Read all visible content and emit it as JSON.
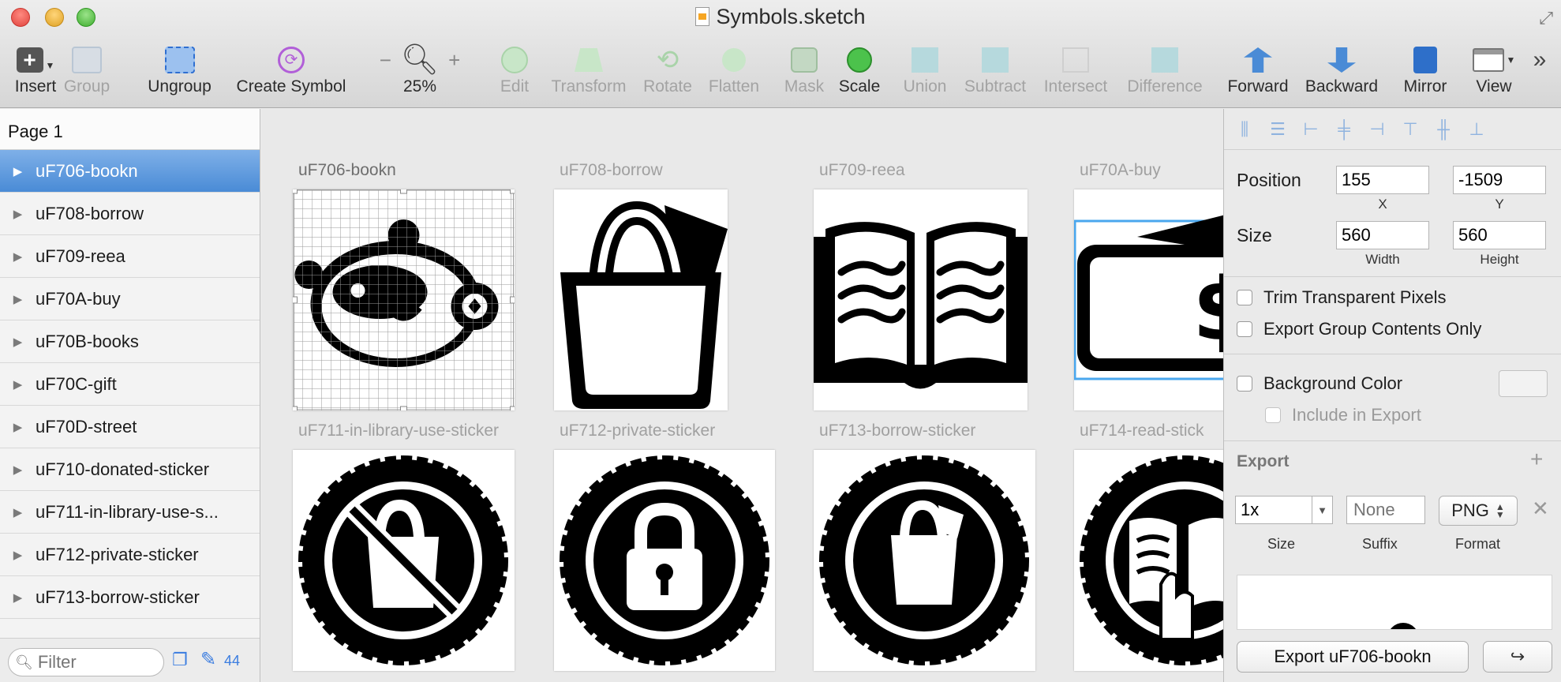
{
  "window": {
    "title": "Symbols.sketch"
  },
  "toolbar": {
    "insert": "Insert",
    "group": "Group",
    "ungroup": "Ungroup",
    "create_symbol": "Create Symbol",
    "zoom_minus": "−",
    "zoom_plus": "+",
    "zoom": "25%",
    "edit": "Edit",
    "transform": "Transform",
    "rotate": "Rotate",
    "flatten": "Flatten",
    "mask": "Mask",
    "scale": "Scale",
    "union": "Union",
    "subtract": "Subtract",
    "intersect": "Intersect",
    "difference": "Difference",
    "forward": "Forward",
    "backward": "Backward",
    "mirror": "Mirror",
    "view": "View",
    "overflow": "»"
  },
  "sidebar": {
    "page": "Page 1",
    "layers": [
      {
        "name": "uF706-bookn",
        "selected": true
      },
      {
        "name": "uF708-borrow"
      },
      {
        "name": "uF709-reea"
      },
      {
        "name": "uF70A-buy"
      },
      {
        "name": "uF70B-books"
      },
      {
        "name": "uF70C-gift"
      },
      {
        "name": "uF70D-street"
      },
      {
        "name": "uF710-donated-sticker"
      },
      {
        "name": "uF711-in-library-use-s..."
      },
      {
        "name": "uF712-private-sticker"
      },
      {
        "name": "uF713-borrow-sticker"
      }
    ],
    "filter_placeholder": "Filter",
    "count": "44"
  },
  "canvas": {
    "artboards": [
      {
        "label": "uF706-bookn",
        "icon": "bear-face-icon",
        "selected": true
      },
      {
        "label": "uF708-borrow",
        "icon": "shopping-bag-icon"
      },
      {
        "label": "uF709-reea",
        "icon": "open-book-icon"
      },
      {
        "label": "uF70A-buy",
        "icon": "dollar-bill-icon"
      },
      {
        "label": "uF711-in-library-use-sticker",
        "icon": "no-bag-sticker-icon"
      },
      {
        "label": "uF712-private-sticker",
        "icon": "lock-sticker-icon"
      },
      {
        "label": "uF713-borrow-sticker",
        "icon": "bag-sticker-icon"
      },
      {
        "label": "uF714-read-stick",
        "icon": "read-sticker-icon"
      }
    ]
  },
  "inspector": {
    "position_label": "Position",
    "x": "155",
    "y": "-1509",
    "x_caption": "X",
    "y_caption": "Y",
    "size_label": "Size",
    "width": "560",
    "height": "560",
    "width_caption": "Width",
    "height_caption": "Height",
    "trim": "Trim Transparent Pixels",
    "group_only": "Export Group Contents Only",
    "bg_color": "Background Color",
    "include_export": "Include in Export",
    "export_title": "Export",
    "export_size": "1x",
    "suffix_placeholder": "None",
    "format": "PNG",
    "size_caption": "Size",
    "suffix_caption": "Suffix",
    "format_caption": "Format",
    "export_button": "Export uF706-bookn"
  },
  "colors": {
    "selection": "#4a8bd6",
    "accent": "#3b7de0"
  }
}
